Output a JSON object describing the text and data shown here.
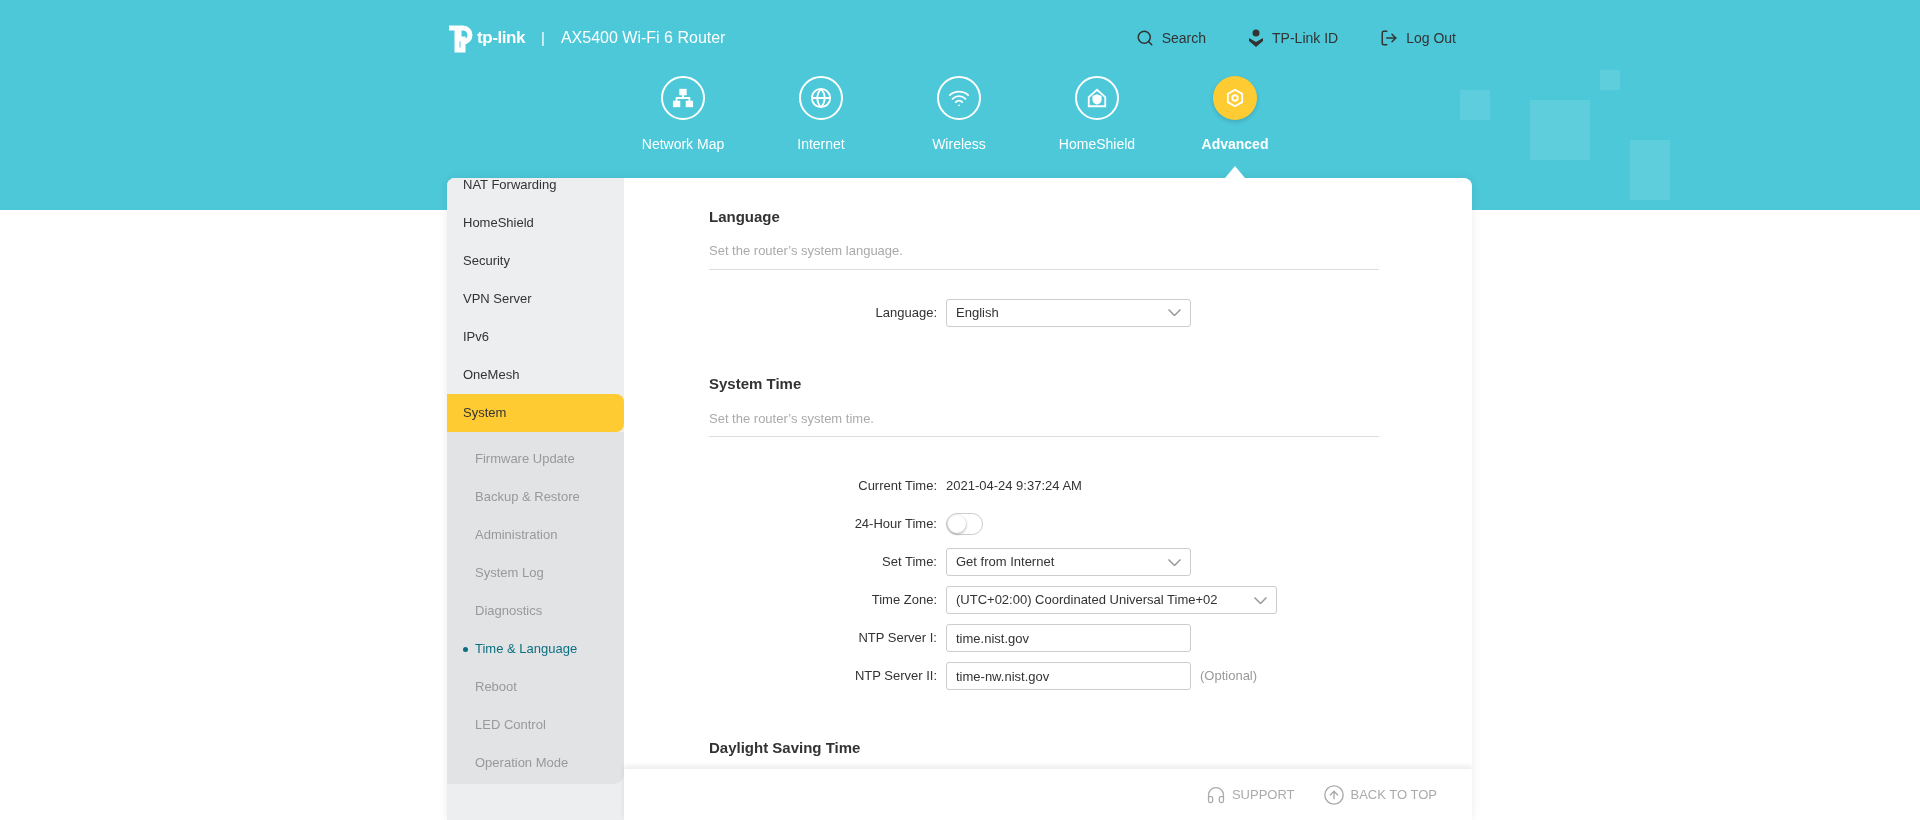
{
  "brand": {
    "logo": "tp-link",
    "separator": "|",
    "model": "AX5400 Wi-Fi 6 Router"
  },
  "top_links": [
    "Search",
    "TP-Link ID",
    "Log Out"
  ],
  "nav": [
    {
      "label": "Network Map",
      "selected": false
    },
    {
      "label": "Internet",
      "selected": false
    },
    {
      "label": "Wireless",
      "selected": false
    },
    {
      "label": "HomeShield",
      "selected": false
    },
    {
      "label": "Advanced",
      "selected": true
    }
  ],
  "sidebar": {
    "items": [
      {
        "label": "NAT Forwarding",
        "selected": false
      },
      {
        "label": "HomeShield",
        "selected": false
      },
      {
        "label": "Security",
        "selected": false
      },
      {
        "label": "VPN Server",
        "selected": false
      },
      {
        "label": "IPv6",
        "selected": false
      },
      {
        "label": "OneMesh",
        "selected": false
      },
      {
        "label": "System",
        "selected": true,
        "children": [
          {
            "label": "Firmware Update",
            "selected": false
          },
          {
            "label": "Backup & Restore",
            "selected": false
          },
          {
            "label": "Administration",
            "selected": false
          },
          {
            "label": "System Log",
            "selected": false
          },
          {
            "label": "Diagnostics",
            "selected": false
          },
          {
            "label": "Time & Language",
            "selected": true
          },
          {
            "label": "Reboot",
            "selected": false
          },
          {
            "label": "LED Control",
            "selected": false
          },
          {
            "label": "Operation Mode",
            "selected": false
          }
        ]
      }
    ]
  },
  "sections": [
    {
      "title": "Language",
      "description": "Set the router’s system language.",
      "fields": [
        {
          "kind": "select",
          "label": "Language:",
          "value": "English"
        }
      ]
    },
    {
      "title": "System Time",
      "description": "Set the router’s system time.",
      "fields": [
        {
          "kind": "text",
          "label": "Current Time:",
          "value": "2021-04-24 9:37:24 AM"
        },
        {
          "kind": "toggle",
          "label": "24-Hour Time:",
          "on": false
        },
        {
          "kind": "select",
          "label": "Set Time:",
          "value": "Get from Internet"
        },
        {
          "kind": "select",
          "label": "Time Zone:",
          "value": "(UTC+02:00) Coordinated Universal Time+02",
          "wide": true
        },
        {
          "kind": "input",
          "label": "NTP Server I:",
          "value": "time.nist.gov"
        },
        {
          "kind": "input",
          "label": "NTP Server II:",
          "value": "time-nw.nist.gov",
          "note": "(Optional)"
        }
      ]
    },
    {
      "title": "Daylight Saving Time"
    }
  ],
  "footer": [
    "SUPPORT",
    "BACK TO TOP"
  ]
}
